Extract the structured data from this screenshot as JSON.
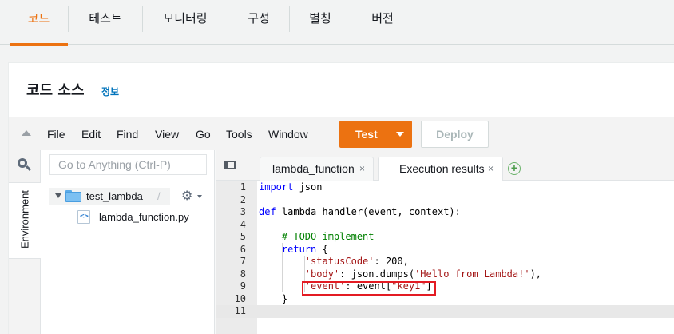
{
  "top_tabs": [
    "코드",
    "테스트",
    "모니터링",
    "구성",
    "별칭",
    "버전"
  ],
  "panel": {
    "title": "코드 소스",
    "info": "정보"
  },
  "menu": [
    "File",
    "Edit",
    "Find",
    "View",
    "Go",
    "Tools",
    "Window"
  ],
  "buttons": {
    "test": "Test",
    "deploy": "Deploy"
  },
  "sidebar": {
    "search_placeholder": "Go to Anything (Ctrl-P)",
    "environment_label": "Environment",
    "folder": "test_lambda",
    "folder_suffix": "/",
    "file": "lambda_function.py",
    "file_icon_glyph": "<>"
  },
  "editor_tabs": [
    {
      "label": "lambda_function",
      "close": "×"
    },
    {
      "label": "Execution results",
      "close": "×"
    }
  ],
  "add_tab_glyph": "+",
  "code_lines": [
    {
      "n": "1",
      "code": "import json"
    },
    {
      "n": "2",
      "code": ""
    },
    {
      "n": "3",
      "code": "def lambda_handler(event, context):"
    },
    {
      "n": "4",
      "code": ""
    },
    {
      "n": "5",
      "code": "    # TODO implement"
    },
    {
      "n": "6",
      "code": "    return {"
    },
    {
      "n": "7",
      "code": "        'statusCode': 200,"
    },
    {
      "n": "8",
      "code": "        'body': json.dumps('Hello from Lambda!'),"
    },
    {
      "n": "9",
      "code": "        'event': event[\"key1\"]"
    },
    {
      "n": "10",
      "code": "    }"
    },
    {
      "n": "11",
      "code": ""
    }
  ],
  "colors": {
    "accent": "#ec7211",
    "link": "#0073bb",
    "highlight": "#e31b23"
  },
  "icons": [
    "search-icon",
    "gear-icon",
    "folder-icon",
    "file-icon",
    "add-tab-icon",
    "collapse-icon",
    "tabs-menu-icon"
  ]
}
